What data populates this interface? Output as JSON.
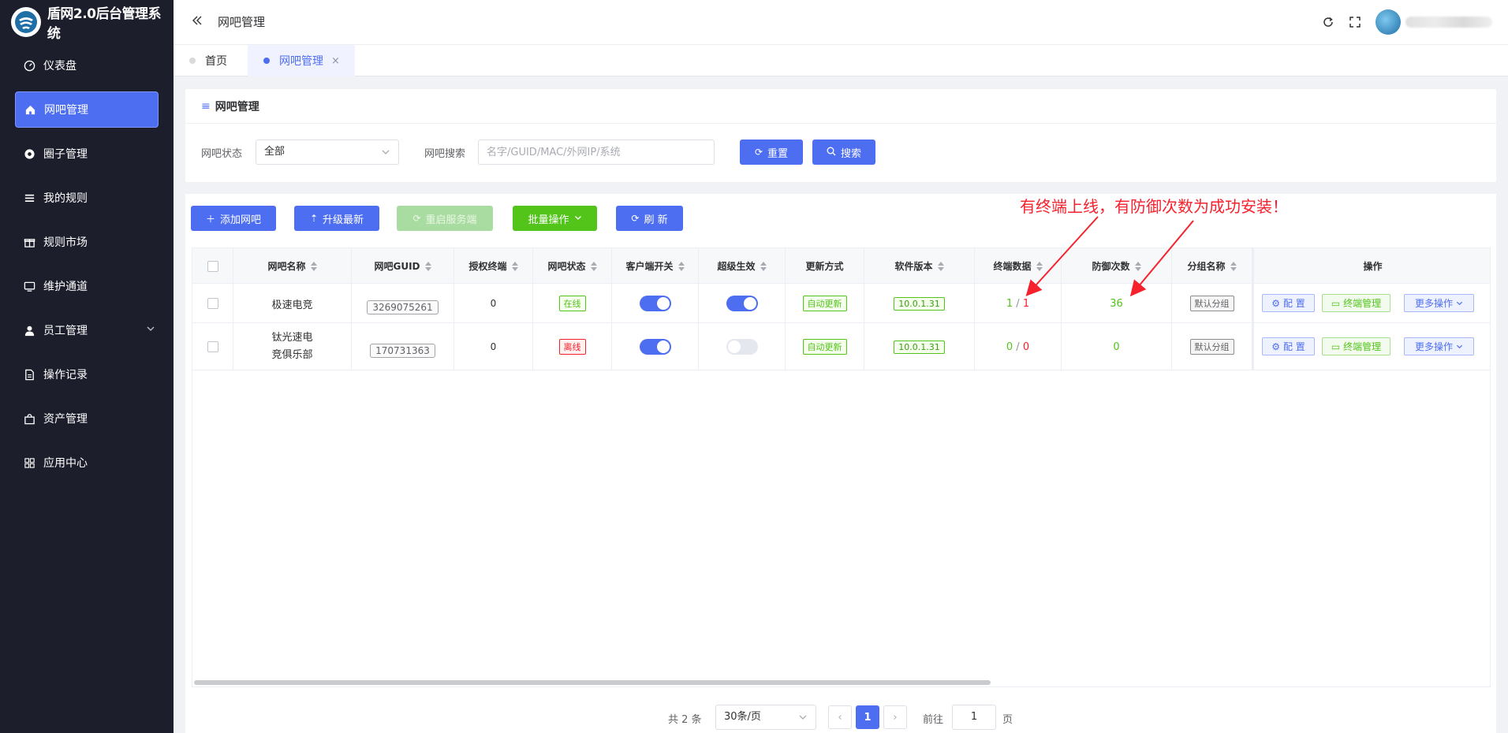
{
  "app": {
    "title": "盾网2.0后台管理系统"
  },
  "sidebar": {
    "items": [
      {
        "label": "仪表盘",
        "icon": "dashboard-icon"
      },
      {
        "label": "网吧管理",
        "icon": "home-icon",
        "active": true
      },
      {
        "label": "圈子管理",
        "icon": "circle-icon"
      },
      {
        "label": "我的规则",
        "icon": "list-icon"
      },
      {
        "label": "规则市场",
        "icon": "gift-icon"
      },
      {
        "label": "维护通道",
        "icon": "monitor-icon"
      },
      {
        "label": "员工管理",
        "icon": "user-icon",
        "has_children": true
      },
      {
        "label": "操作记录",
        "icon": "document-icon"
      },
      {
        "label": "资产管理",
        "icon": "bag-icon"
      },
      {
        "label": "应用中心",
        "icon": "apps-icon"
      }
    ]
  },
  "header": {
    "title": "网吧管理"
  },
  "tabs": {
    "home": "首页",
    "active": "网吧管理",
    "close": "×"
  },
  "panel": {
    "title": "网吧管理",
    "status_label": "网吧状态",
    "status_value": "全部",
    "search_label": "网吧搜索",
    "search_placeholder": "名字/GUID/MAC/外网IP/系统",
    "reset_label": "重置",
    "search_button": "搜索"
  },
  "toolbar": {
    "add_label": "添加网吧",
    "upgrade_label": "升级最新",
    "restart_label": "重启服务端",
    "batch_label": "批量操作",
    "refresh_label": "刷 新"
  },
  "annotation": "有终端上线，有防御次数为成功安装！",
  "table": {
    "columns": [
      "网吧名称",
      "网吧GUID",
      "授权终端",
      "网吧状态",
      "客户端开关",
      "超级生效",
      "更新方式",
      "软件版本",
      "终端数据",
      "防御次数",
      "分组名称",
      "操作"
    ],
    "rows": [
      {
        "name": "极速电竞",
        "guid": "3269075261",
        "licensed": "0",
        "status": "在线",
        "client_on": true,
        "super_on": true,
        "update_mode": "自动更新",
        "version": "10.0.1.31",
        "term_online": "1",
        "term_sep": " / ",
        "term_total": "1",
        "defense": "36",
        "group": "默认分组"
      },
      {
        "name": "钛光速电竞俱乐部",
        "guid": "170731363",
        "licensed": "0",
        "status": "离线",
        "client_on": true,
        "super_on": false,
        "update_mode": "自动更新",
        "version": "10.0.1.31",
        "term_online": "0",
        "term_sep": " / ",
        "term_total": "0",
        "defense": "0",
        "group": "默认分组"
      }
    ],
    "ops": {
      "config": "配 置",
      "terminal": "终端管理",
      "more": "更多操作"
    }
  },
  "pagination": {
    "total": "共 2 条",
    "page_size": "30条/页",
    "current": "1",
    "goto_label": "前往",
    "goto_value": "1",
    "goto_unit": "页"
  },
  "colors": {
    "primary": "#4e6ef2",
    "success": "#52c41a",
    "danger": "#f5222d",
    "sidebar": "#1d1e2c"
  }
}
